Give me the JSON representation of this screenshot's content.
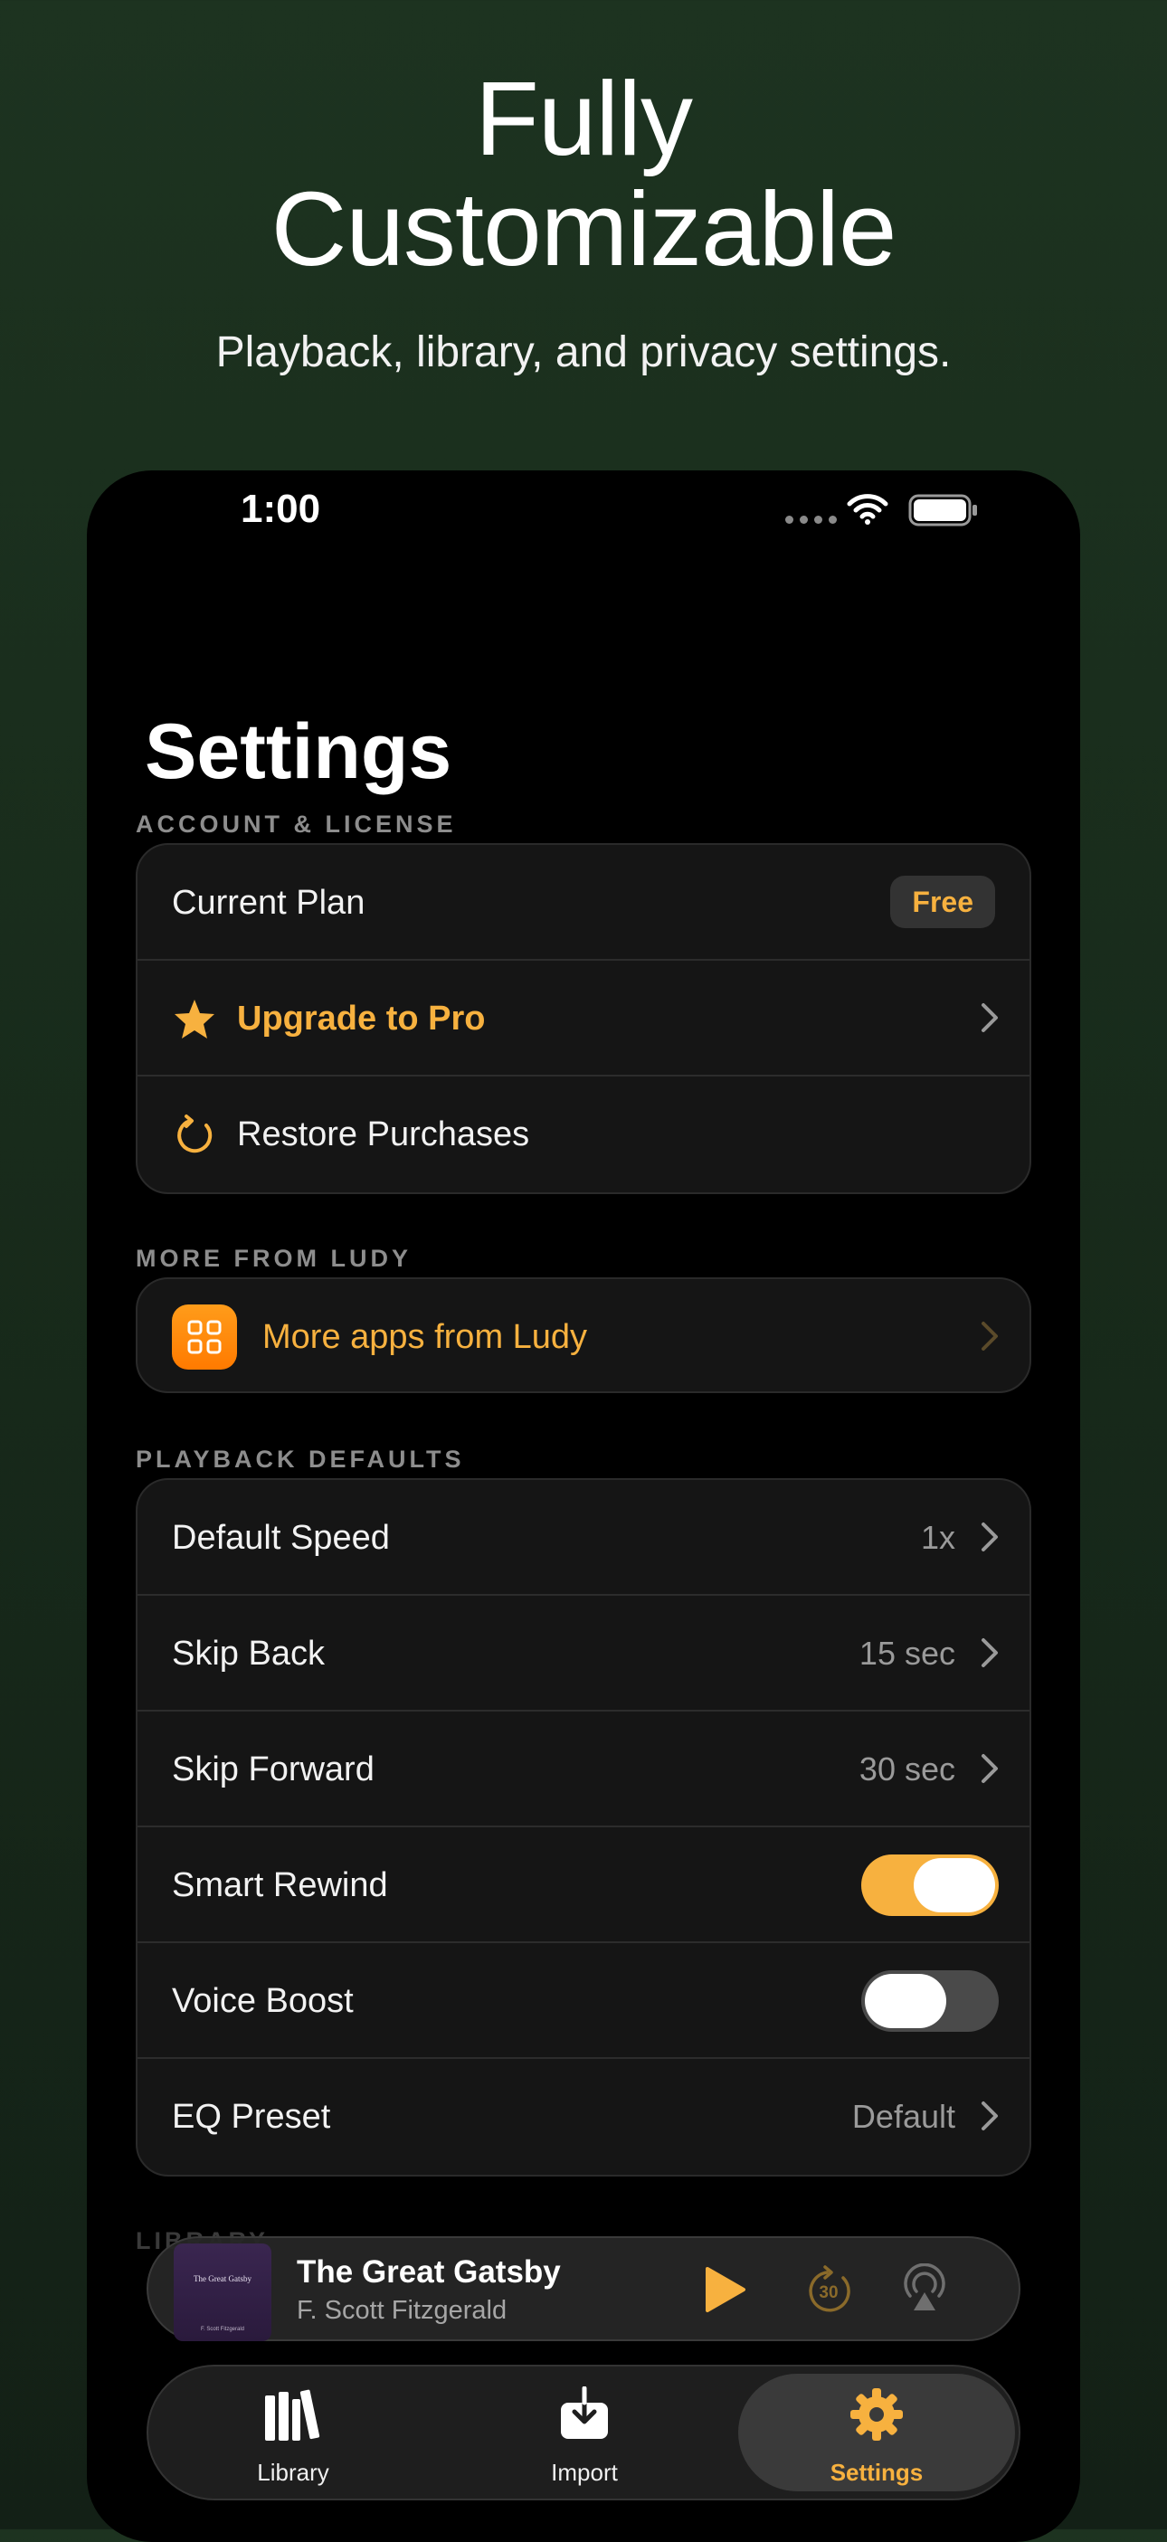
{
  "headline": {
    "title_line1": "Fully",
    "title_line2": "Customizable",
    "subtitle": "Playback, library, and privacy settings."
  },
  "status_bar": {
    "time": "1:00"
  },
  "page_title": "Settings",
  "account": {
    "header": "ACCOUNT & LICENSE",
    "current_plan_label": "Current Plan",
    "current_plan_badge": "Free",
    "upgrade_label": "Upgrade to Pro",
    "restore_label": "Restore Purchases"
  },
  "more": {
    "header": "MORE FROM LUDY",
    "apps_label": "More apps from Ludy"
  },
  "playback": {
    "header": "PLAYBACK DEFAULTS",
    "rows": [
      {
        "label": "Default Speed",
        "value": "1x"
      },
      {
        "label": "Skip Back",
        "value": "15 sec"
      },
      {
        "label": "Skip Forward",
        "value": "30 sec"
      },
      {
        "label": "Smart Rewind",
        "toggle": true
      },
      {
        "label": "Voice Boost",
        "toggle": false
      },
      {
        "label": "EQ Preset",
        "value": "Default"
      }
    ]
  },
  "library_header": "LIBRARY",
  "mini_player": {
    "title": "The Great Gatsby",
    "author": "F. Scott Fitzgerald",
    "cover_title": "The Great Gatsby",
    "cover_author": "F. Scott Fitzgerald",
    "skip_seconds": "30"
  },
  "tabs": [
    {
      "label": "Library",
      "icon": "books-icon"
    },
    {
      "label": "Import",
      "icon": "import-icon"
    },
    {
      "label": "Settings",
      "icon": "gear-icon",
      "active": true
    }
  ],
  "colors": {
    "accent": "#f7b13f",
    "background_top": "#1d3320",
    "card": "#151515",
    "orange_icon": "#ff8a00"
  }
}
